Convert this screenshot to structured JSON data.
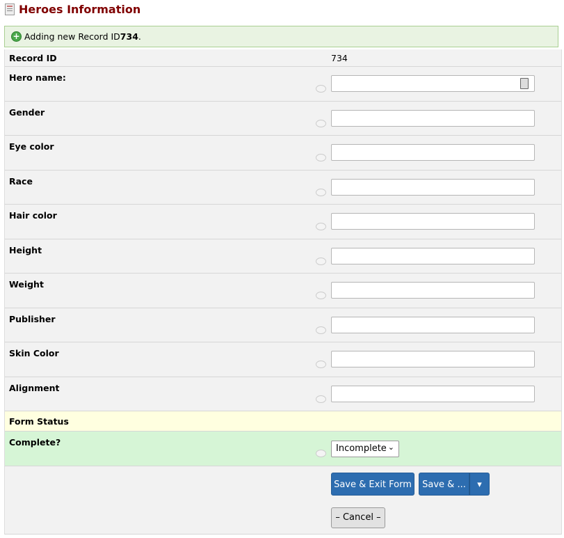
{
  "header": {
    "title": "Heroes Information",
    "icon": "form-icon"
  },
  "notice": {
    "text": "Adding new Record ID ",
    "record_id": "734",
    "suffix": ".",
    "icon": "plus-circle-icon"
  },
  "record": {
    "label": "Record ID",
    "value": "734"
  },
  "fields": [
    {
      "label": "Hero name:",
      "value": "",
      "has_lock": true
    },
    {
      "label": "Gender",
      "value": ""
    },
    {
      "label": "Eye color",
      "value": ""
    },
    {
      "label": "Race",
      "value": ""
    },
    {
      "label": "Hair color",
      "value": ""
    },
    {
      "label": "Height",
      "value": ""
    },
    {
      "label": "Weight",
      "value": ""
    },
    {
      "label": "Publisher",
      "value": ""
    },
    {
      "label": "Skin Color",
      "value": ""
    },
    {
      "label": "Alignment",
      "value": ""
    }
  ],
  "form_status": {
    "header": "Form Status",
    "complete_label": "Complete?",
    "complete_value": "Incomplete"
  },
  "actions": {
    "save_exit": "Save & Exit Form",
    "save_more": "Save & ...",
    "cancel": "– Cancel –"
  }
}
